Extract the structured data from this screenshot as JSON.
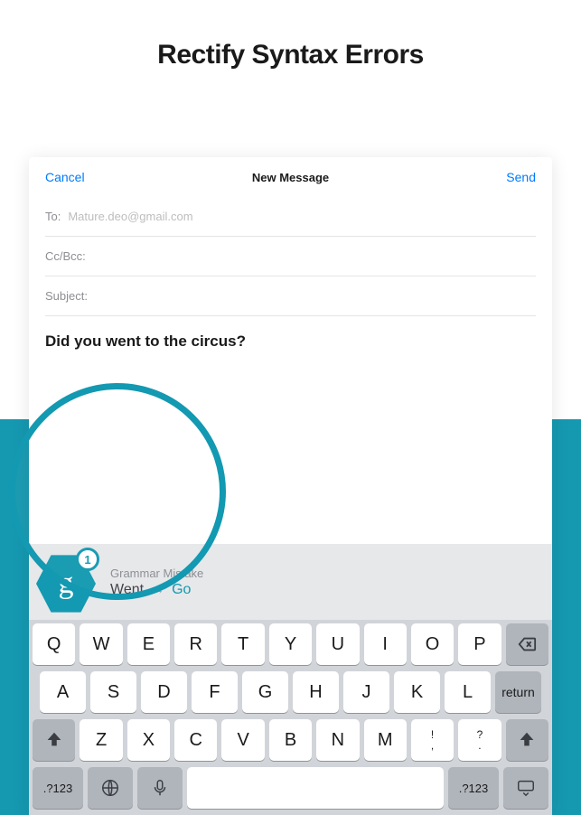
{
  "page_title": "Rectify Syntax Errors",
  "compose": {
    "cancel": "Cancel",
    "title": "New Message",
    "send": "Send",
    "to_label": "To:",
    "to_value": "Mature.deo@gmail.com",
    "ccbcc_label": "Cc/Bcc:",
    "subject_label": "Subject:",
    "body": "Did you went to the circus?"
  },
  "suggestion": {
    "badge_letter": "g",
    "badge_count": "1",
    "title": "Grammar Mistake",
    "from": "Went",
    "arrow": "→",
    "to": "Go"
  },
  "keyboard": {
    "row1": [
      "Q",
      "W",
      "E",
      "R",
      "T",
      "Y",
      "U",
      "I",
      "O",
      "P"
    ],
    "row2": [
      "A",
      "S",
      "D",
      "F",
      "G",
      "H",
      "J",
      "K",
      "L"
    ],
    "row2_return": "return",
    "row3_letters": [
      "Z",
      "X",
      "C",
      "V",
      "B",
      "N",
      "M"
    ],
    "row3_punct1": "!\n,",
    "row3_punct2": "?\n.",
    "row4_sym": ".?123"
  }
}
